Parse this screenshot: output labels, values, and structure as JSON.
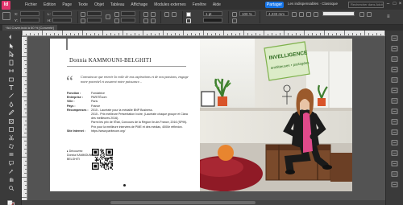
{
  "app": {
    "logo": "Id"
  },
  "menu": [
    "Fichier",
    "Edition",
    "Page",
    "Texte",
    "Objet",
    "Tableau",
    "Affichage",
    "Modules externes",
    "Fenêtre",
    "Aide"
  ],
  "header": {
    "share": "Partager",
    "workspace": "Les indispensables · Classique",
    "search_placeholder": "Rechercher dans Adobe Stock"
  },
  "control": {
    "x_label": "X:",
    "x_value": "",
    "y_label": "Y:",
    "y_value": "",
    "w_label": "L:",
    "h_label": "H:",
    "stroke_weight": "1 pt",
    "opacity": "100 %",
    "zoom_value": "4,233 mm"
  },
  "tab": {
    "title": "*A4 Cover.indd à 60 % [Convertir]"
  },
  "page": {
    "name": "Donnia KAMMOUNI-BELGHITI",
    "quote_mark": "“",
    "quote": "Convaincue que retenir la voile de nos aspirations et de nos passions, engage notre potentiel et assurent notre puissance...",
    "info": [
      {
        "label": "Fonction :",
        "value": "Fondatrice"
      },
      {
        "label": "Entreprise :",
        "value": "PARITÉcom"
      },
      {
        "label": "Ville :",
        "value": "Paris"
      },
      {
        "label": "Pays :",
        "value": "France"
      },
      {
        "label": "Récompenses :",
        "value": "2015 - Lauréate pour la médaille BNP Business."
      },
      {
        "label": "",
        "value": "2015 - Prix meilleure Présentation Ivoire, (Lauréate chaque groupe et Clara des meilleures 2016)."
      },
      {
        "label": "",
        "value": "Parmi les prix de l'État, Concours de la Région Ile-de-France, 2016 (SPIN)."
      },
      {
        "label": "",
        "value": "Prix pour la meilleure interview de PME et des médias, 4000e réflexion."
      },
      {
        "label": "Site Internet :",
        "value": "https://www.paritecom.org/"
      }
    ],
    "contact": [
      "▸ Découvrez",
      "Donnia KAMMOUNI-",
      "BELGHITI"
    ],
    "photo": {
      "sign_line1": "INVELLIGENCE",
      "sign_line2": "ambitieuses • partagées"
    }
  },
  "colors": {
    "menubar": "#323232",
    "panel": "#3c3c3c",
    "accent": "#1473e6",
    "logo": "#e0356c",
    "pasteboard": "#535353"
  },
  "icons": {
    "tools": [
      "selection-tool-icon",
      "direct-selection-icon",
      "page-tool-icon",
      "gap-tool-icon",
      "content-collector-icon",
      "type-tool-icon",
      "line-tool-icon",
      "pen-tool-icon",
      "pencil-tool-icon",
      "rectangle-frame-icon",
      "rectangle-tool-icon",
      "scissors-icon",
      "free-transform-icon",
      "gradient-icon",
      "note-icon",
      "eyedropper-icon",
      "hand-icon",
      "zoom-icon",
      "fill-stroke-icon"
    ]
  }
}
